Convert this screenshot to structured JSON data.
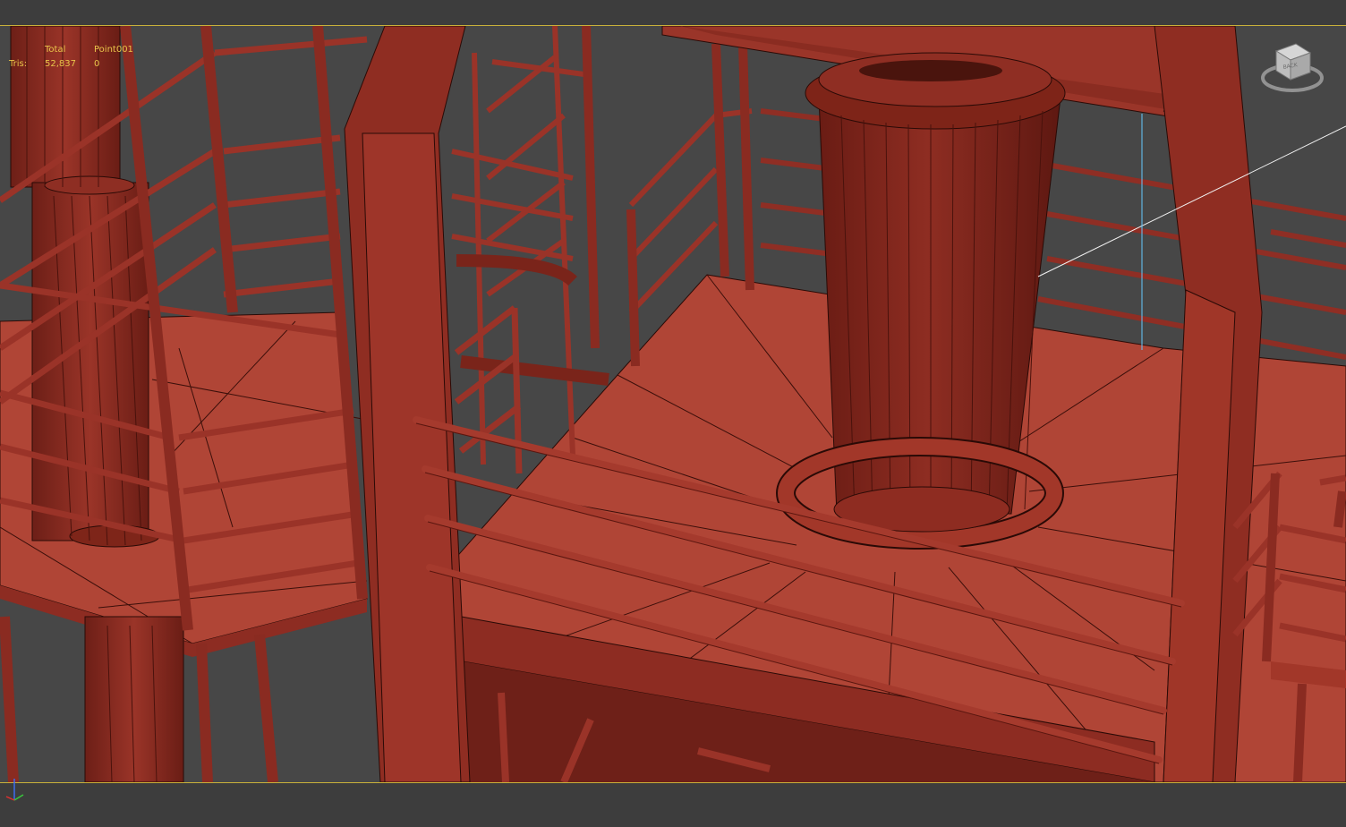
{
  "viewport": {
    "stats": {
      "header_total": "Total",
      "header_object": "Point001",
      "row_label": "Tris:",
      "total_value": "52,837",
      "object_value": "0"
    },
    "viewcube_label": "BACK"
  },
  "colors": {
    "accent": "#c9b13a",
    "model": "#a63a2e",
    "model_light": "#b84a3c",
    "model_dark": "#7a2219",
    "background": "#474747"
  },
  "icons": {
    "viewcube": "viewcube-icon",
    "axis": "axis-tripod-icon"
  }
}
